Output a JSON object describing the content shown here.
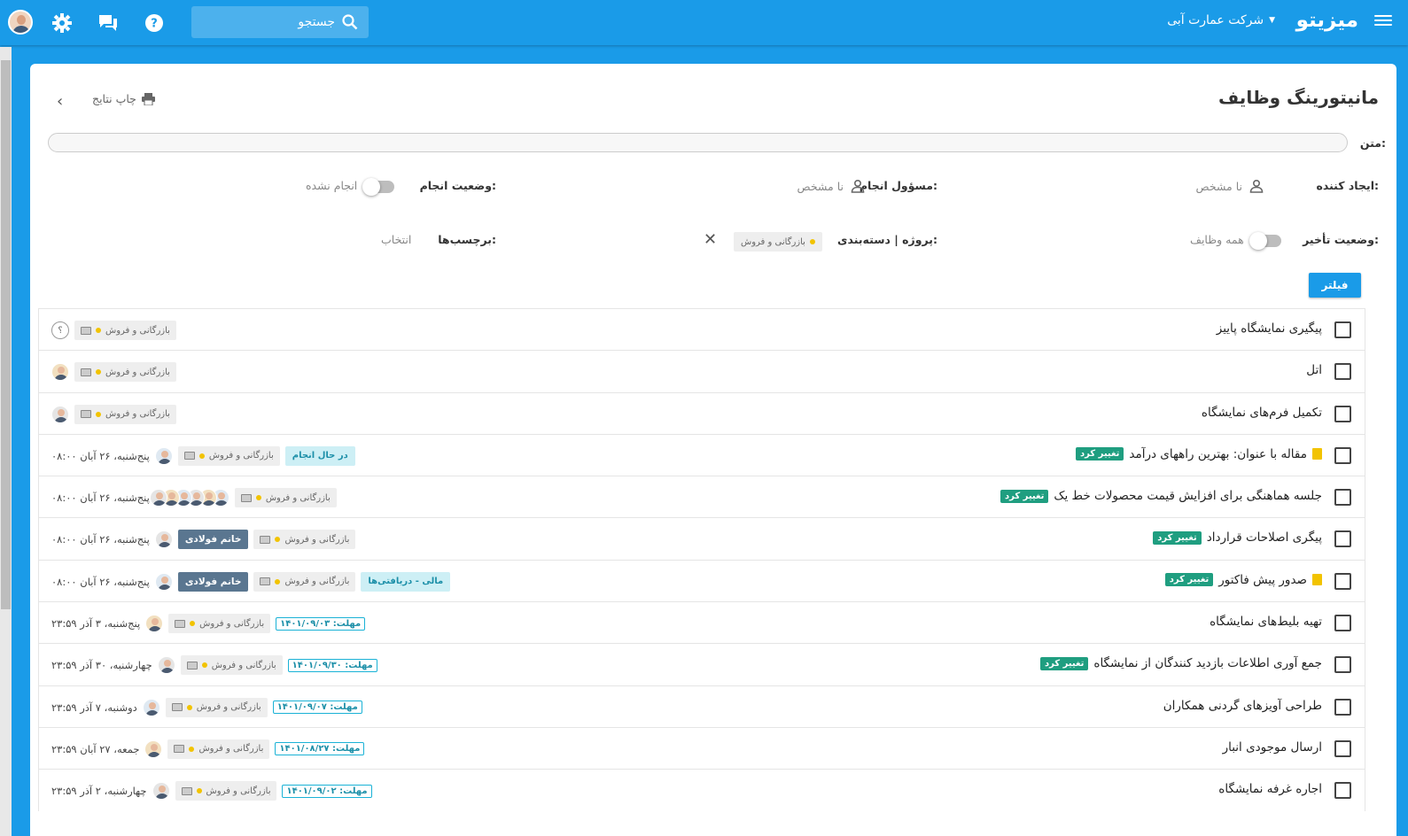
{
  "header": {
    "logo": "میزیتو",
    "company": "شرکت عمارت آبی",
    "search_placeholder": "جستجو"
  },
  "page": {
    "title": "مانیتورینگ وظایف",
    "print_label": "چاپ نتایج"
  },
  "filters": {
    "text_label": "متن:",
    "creator_label": "ایجاد کننده:",
    "creator_value": "نا مشخص",
    "assignee_label": "مسؤول انجام:",
    "assignee_value": "نا مشخص",
    "status_label": "وضعیت انجام:",
    "status_value": "انجام نشده",
    "delay_label": "وضعیت تأخیر:",
    "delay_value": "همه وظایف",
    "project_label": "پروژه | دسته‌بندی:",
    "project_value": "بازرگانی و فروش",
    "tags_label": "برچسب‌ها:",
    "tags_value": "انتخاب",
    "filter_button": "فیلتر"
  },
  "tasks": [
    {
      "title": "پیگیری نمایشگاه پاییز",
      "project": "بازرگانی و فروش",
      "unknown": "؟"
    },
    {
      "title": "اتل",
      "project": "بازرگانی و فروش"
    },
    {
      "title": "تکمیل فرم‌های نمایشگاه",
      "project": "بازرگانی و فروش"
    },
    {
      "title": "مقاله با عنوان: بهترین راههای درآمد",
      "changed": "تغییر کرد",
      "project": "بازرگانی و فروش",
      "status": "در حال انجام",
      "date": "پنج‌شنبه، ۲۶ آبان ۰۸:۰۰"
    },
    {
      "title": "جلسه هماهنگی برای افزایش قیمت محصولات خط یک",
      "changed": "تغییر کرد",
      "project": "بازرگانی و فروش",
      "date": "پنج‌شنبه، ۲۶ آبان ۰۸:۰۰"
    },
    {
      "title": "پیگری اصلاحات قرارداد",
      "changed": "تغییر کرد",
      "project": "بازرگانی و فروش",
      "person": "خانم فولادی",
      "date": "پنج‌شنبه، ۲۶ آبان ۰۸:۰۰"
    },
    {
      "title": "صدور پیش فاکتور",
      "changed": "تغییر کرد",
      "project": "بازرگانی و فروش",
      "person": "خانم فولادی",
      "status": "مالی - دریافتی‌ها",
      "date": "پنج‌شنبه، ۲۶ آبان ۰۸:۰۰"
    },
    {
      "title": "تهیه بلیط‌های نمایشگاه",
      "project": "بازرگانی و فروش",
      "deadline": "مهلت: ۱۴۰۱/۰۹/۰۳",
      "date": "پنج‌شنبه، ۳ آذر ۲۳:۵۹"
    },
    {
      "title": "جمع آوری اطلاعات بازدید کنندگان از نمایشگاه",
      "changed": "تغییر کرد",
      "project": "بازرگانی و فروش",
      "deadline": "مهلت: ۱۴۰۱/۰۹/۳۰",
      "date": "چهارشنبه، ۳۰ آذر ۲۳:۵۹"
    },
    {
      "title": "طراحی آویزهای گردنی همکاران",
      "project": "بازرگانی و فروش",
      "deadline": "مهلت: ۱۴۰۱/۰۹/۰۷",
      "date": "دوشنبه، ۷ آذر ۲۳:۵۹"
    },
    {
      "title": "ارسال موجودی انبار",
      "project": "بازرگانی و فروش",
      "deadline": "مهلت: ۱۴۰۱/۰۸/۲۷",
      "date": "جمعه، ۲۷ آبان ۲۳:۵۹"
    },
    {
      "title": "اجاره غرفه نمایشگاه",
      "project": "بازرگانی و فروش",
      "deadline": "مهلت: ۱۴۰۱/۰۹/۰۲",
      "date": "چهارشنبه، ۲ آذر ۲۳:۵۹"
    }
  ]
}
